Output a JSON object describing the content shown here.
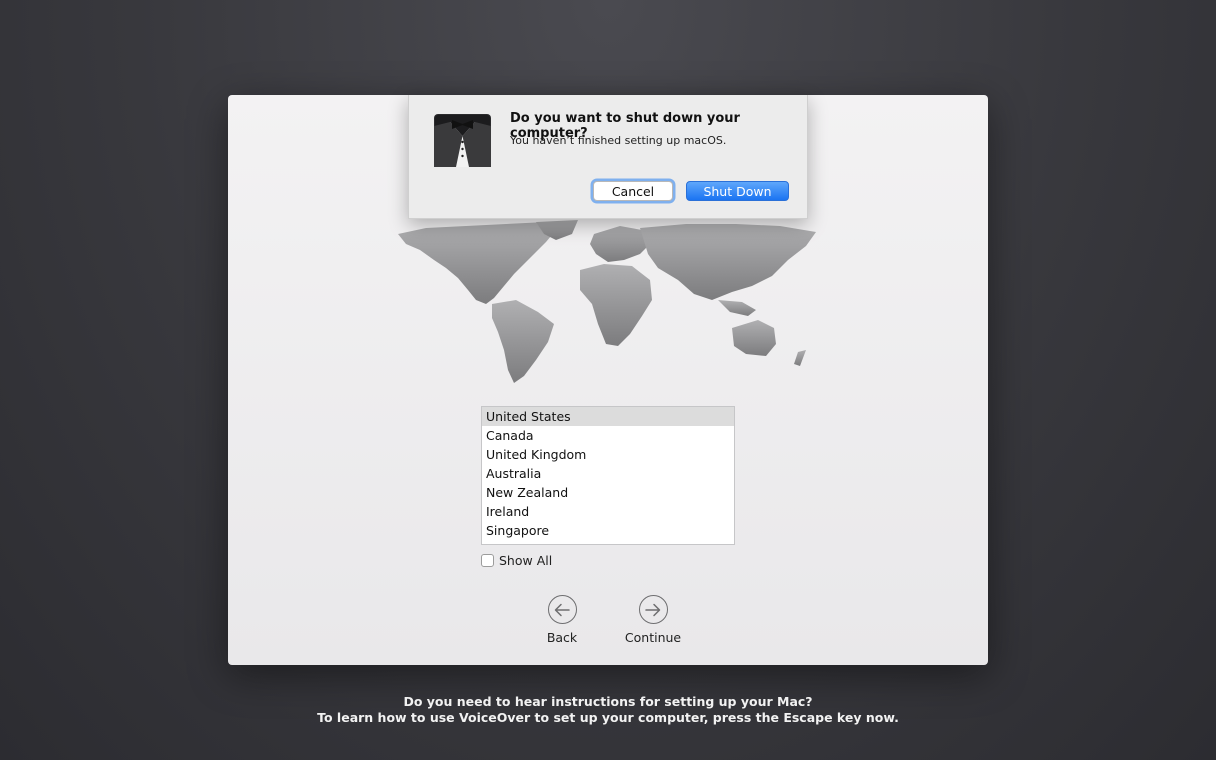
{
  "alert": {
    "title": "Do you want to shut down your computer?",
    "message": "You haven’t finished setting up macOS.",
    "cancel_label": "Cancel",
    "shutdown_label": "Shut Down",
    "icon": "tuxedo-butler-icon"
  },
  "region": {
    "countries": [
      "United States",
      "Canada",
      "United Kingdom",
      "Australia",
      "New Zealand",
      "Ireland",
      "Singapore"
    ],
    "selected": "United States",
    "show_all_label": "Show All",
    "show_all_checked": false
  },
  "nav": {
    "back_label": "Back",
    "continue_label": "Continue"
  },
  "voiceover": {
    "line1": "Do you need to hear instructions for setting up your Mac?",
    "line2": "To learn how to use VoiceOver to set up your computer, press the Escape key now."
  },
  "colors": {
    "accent": "#1b74f2",
    "background": "#38383d",
    "map": "#8d8d8f"
  }
}
